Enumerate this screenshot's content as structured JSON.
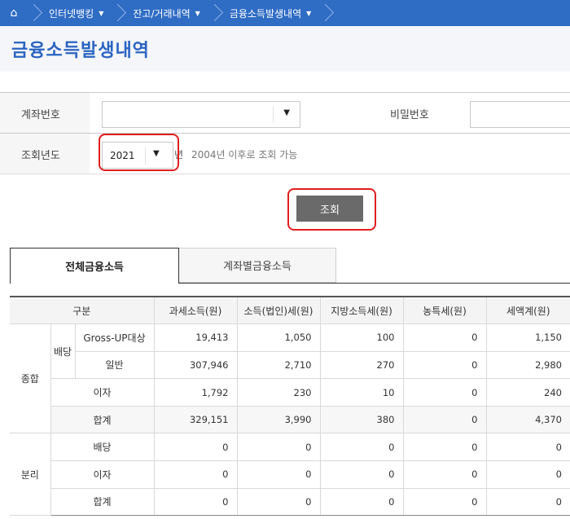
{
  "breadcrumb": {
    "items": [
      {
        "label": "인터넷뱅킹"
      },
      {
        "label": "잔고/거래내역"
      },
      {
        "label": "금융소득발생내역"
      }
    ]
  },
  "page_title": "금융소득발생내역",
  "form": {
    "account_label": "계좌번호",
    "account_value": "",
    "password_label": "비밀번호",
    "password_value": "",
    "year_label": "조회년도",
    "year_value": "2021",
    "year_unit": "년",
    "year_note": "2004년 이후로 조회 가능",
    "search_button": "조회"
  },
  "tabs": [
    {
      "label": "전체금융소득",
      "active": true
    },
    {
      "label": "계좌별금융소득",
      "active": false
    }
  ],
  "table": {
    "headers": [
      "구분",
      "과세소득(원)",
      "소득(법인)세(원)",
      "지방소득세(원)",
      "농특세(원)",
      "세액계(원)"
    ],
    "groups": {
      "comprehensive": "종합",
      "separate": "분리",
      "dividend": "배당"
    },
    "comprehensive_rows": [
      {
        "label": "Gross-UP대상",
        "values": [
          "19,413",
          "1,050",
          "100",
          "0",
          "1,150"
        ]
      },
      {
        "label": "일반",
        "values": [
          "307,946",
          "2,710",
          "270",
          "0",
          "2,980"
        ]
      },
      {
        "label": "이자",
        "values": [
          "1,792",
          "230",
          "10",
          "0",
          "240"
        ]
      },
      {
        "label": "합계",
        "values": [
          "329,151",
          "3,990",
          "380",
          "0",
          "4,370"
        ]
      }
    ],
    "separate_rows": [
      {
        "label": "배당",
        "values": [
          "0",
          "0",
          "0",
          "0",
          "0"
        ]
      },
      {
        "label": "이자",
        "values": [
          "0",
          "0",
          "0",
          "0",
          "0"
        ]
      },
      {
        "label": "합계",
        "values": [
          "0",
          "0",
          "0",
          "0",
          "0"
        ]
      }
    ]
  },
  "colors": {
    "brand": "#2f6cc4",
    "title": "#2b64c2",
    "highlight": "#e01e1e",
    "button": "#6a6a6a"
  }
}
